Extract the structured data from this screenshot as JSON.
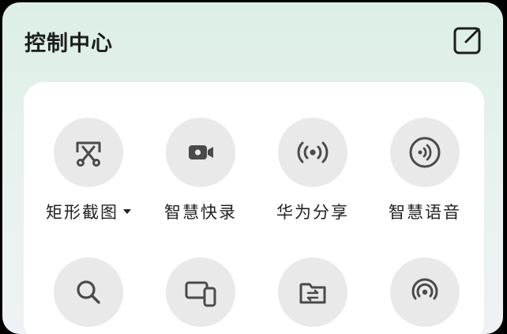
{
  "header": {
    "title": "控制中心"
  },
  "tiles": [
    {
      "label": "矩形截图",
      "icon": "scissors-screenshot-icon"
    },
    {
      "label": "智慧快录",
      "icon": "video-record-icon"
    },
    {
      "label": "华为分享",
      "icon": "share-broadcast-icon"
    },
    {
      "label": "智慧语音",
      "icon": "voice-assistant-icon"
    },
    {
      "label": "",
      "icon": "search-icon"
    },
    {
      "label": "",
      "icon": "multi-screen-icon"
    },
    {
      "label": "",
      "icon": "file-transfer-icon"
    },
    {
      "label": "",
      "icon": "hotspot-icon"
    }
  ]
}
